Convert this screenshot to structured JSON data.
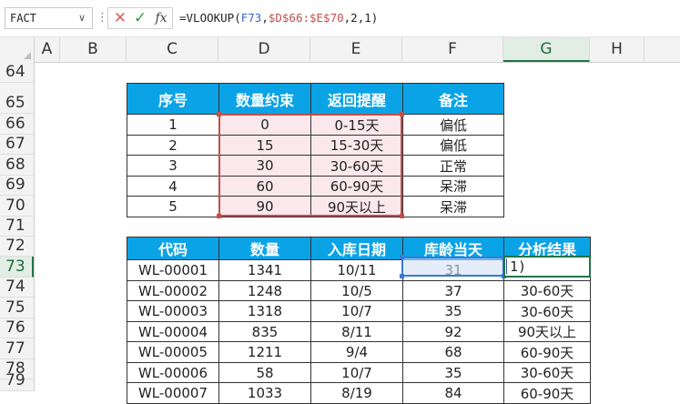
{
  "formula_bar": {
    "name_box": "FACT",
    "dots": "⋮",
    "cancel_glyph": "✕",
    "enter_glyph": "✓",
    "fx_label": "fx",
    "formula_prefix": "=VLOOKUP(",
    "formula_ref1": "F73",
    "formula_sep1": ",",
    "formula_ref2": "$D$66:$E$70",
    "formula_suffix": ",2,1)"
  },
  "columns": [
    "A",
    "B",
    "C",
    "D",
    "E",
    "F",
    "G",
    "H"
  ],
  "rows": [
    "64",
    "65",
    "66",
    "67",
    "68",
    "69",
    "70",
    "71",
    "72",
    "73",
    "74",
    "75",
    "76",
    "77",
    "78",
    "79"
  ],
  "table1": {
    "headers": [
      "序号",
      "数量约束",
      "返回提醒",
      "备注"
    ],
    "rows": [
      [
        "1",
        "0",
        "0-15天",
        "偏低"
      ],
      [
        "2",
        "15",
        "15-30天",
        "偏低"
      ],
      [
        "3",
        "30",
        "30-60天",
        "正常"
      ],
      [
        "4",
        "60",
        "60-90天",
        "呆滞"
      ],
      [
        "5",
        "90",
        "90天以上",
        "呆滞"
      ]
    ]
  },
  "table2": {
    "headers": [
      "代码",
      "数量",
      "入库日期",
      "库龄当天",
      "分析结果"
    ],
    "rows": [
      [
        "WL-00001",
        "1341",
        "10/11",
        "31",
        "1)"
      ],
      [
        "WL-00002",
        "1248",
        "10/5",
        "37",
        "30-60天"
      ],
      [
        "WL-00003",
        "1318",
        "10/7",
        "35",
        "30-60天"
      ],
      [
        "WL-00004",
        "835",
        "8/11",
        "92",
        "90天以上"
      ],
      [
        "WL-00005",
        "1211",
        "9/4",
        "68",
        "60-90天"
      ],
      [
        "WL-00006",
        "58",
        "10/7",
        "35",
        "30-60天"
      ],
      [
        "WL-00007",
        "1033",
        "8/19",
        "84",
        "60-90天"
      ]
    ]
  },
  "colors": {
    "header_blue": "#0aa3e6",
    "range_red": "#c0504d",
    "ref_blue": "#3a78d8",
    "active_green": "#217346",
    "range_fill": "#fbe8ec"
  }
}
